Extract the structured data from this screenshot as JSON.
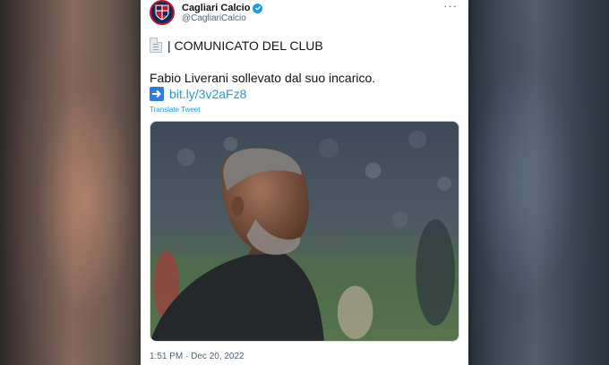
{
  "account": {
    "name": "Cagliari Calcio",
    "handle": "@CagliariCalcio",
    "verified": true,
    "avatar_icon": "club-crest-icon"
  },
  "menu": {
    "more_label": "···"
  },
  "tweet": {
    "headline": "| COMUNICATO DEL CLUB",
    "headline_icon": "document-icon",
    "body": "Fabio Liverani sollevato dal suo incarico.",
    "link_icon": "right-arrow-icon",
    "link": "bit.ly/3v2aFz8",
    "translate_label": "Translate Tweet",
    "timestamp": "1:51 PM · Dec 20, 2022"
  },
  "colors": {
    "link": "#1d9bf0",
    "verified": "#1d9bf0",
    "club_red": "#c0182c",
    "club_blue": "#0d2a5c"
  }
}
